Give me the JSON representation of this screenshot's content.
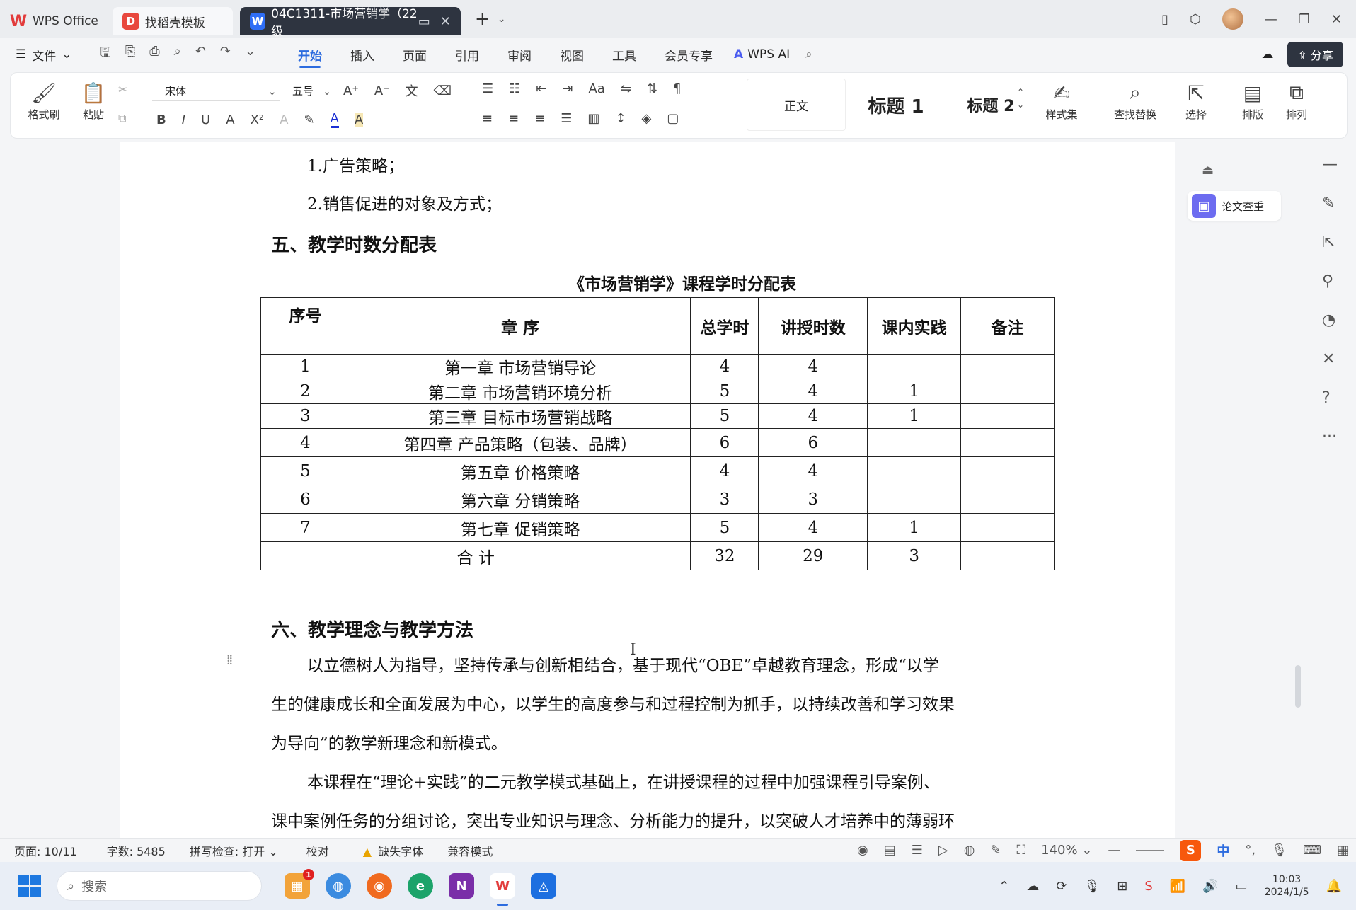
{
  "tabs": {
    "app_name": "WPS Office",
    "template_tab": "找稻壳模板",
    "document_tab": "04C1311-市场营销学（22级"
  },
  "menubar": {
    "file_label": "文件",
    "items": [
      "开始",
      "插入",
      "页面",
      "引用",
      "审阅",
      "视图",
      "工具",
      "会员专享"
    ],
    "active_item": "开始",
    "ai_label": "WPS AI",
    "share_label": "分享"
  },
  "ribbon": {
    "format_painter": "格式刷",
    "paste": "粘贴",
    "font_name": "宋体",
    "font_size": "五号",
    "style_normal": "正文",
    "style_h1": "标题 1",
    "style_h2": "标题 2",
    "style_set": "样式集",
    "find_replace": "查找替换",
    "select": "选择",
    "layout": "排版",
    "arrange": "排列"
  },
  "document": {
    "line1": "1.广告策略；",
    "line2": "2.销售促进的对象及方式；",
    "heading5": "五、教学时数分配表",
    "table_title": "《市场营销学》课程学时分配表",
    "table": {
      "headers": [
        "序号",
        "章 序",
        "总学时",
        "讲授时数",
        "课内实践",
        "备注"
      ],
      "rows": [
        [
          "1",
          "第一章  市场营销导论",
          "4",
          "4",
          "",
          ""
        ],
        [
          "2",
          "第二章  市场营销环境分析",
          "5",
          "4",
          "1",
          ""
        ],
        [
          "3",
          "第三章  目标市场营销战略",
          "5",
          "4",
          "1",
          ""
        ],
        [
          "4",
          "第四章  产品策略（包装、品牌）",
          "6",
          "6",
          "",
          ""
        ],
        [
          "5",
          "第五章  价格策略",
          "4",
          "4",
          "",
          ""
        ],
        [
          "6",
          "第六章  分销策略",
          "3",
          "3",
          "",
          ""
        ],
        [
          "7",
          "第七章  促销策略",
          "5",
          "4",
          "1",
          ""
        ]
      ],
      "total": [
        "合 计",
        "32",
        "29",
        "3",
        ""
      ]
    },
    "heading6": "六、教学理念与教学方法",
    "para1_l1": "以立德树人为指导，坚持传承与创新相结合，基于现代“OBE”卓越教育理念，形成“以学",
    "para1_l2": "生的健康成长和全面发展为中心，以学生的高度参与和过程控制为抓手，以持续改善和学习效果",
    "para1_l3": "为导向”的教学新理念和新模式。",
    "para2_l1": "本课程在“理论+实践”的二元教学模式基础上，在讲授课程的过程中加强课程引导案例、",
    "para2_l2": "课中案例任务的分组讨论，突出专业知识与理念、分析能力的提升，以突破人才培养中的薄弱环"
  },
  "side_panel": {
    "paper_check": "论文查重"
  },
  "statusbar": {
    "page": "页面: 10/11",
    "word_count": "字数: 5485",
    "spell_check": "拼写检查: 打开",
    "proofread": "校对",
    "missing_font": "缺失字体",
    "compat_mode": "兼容模式",
    "zoom": "140%",
    "ime_lang": "中"
  },
  "taskbar": {
    "search_placeholder": "搜索",
    "time": "10:03",
    "date": "2024/1/5",
    "notification_count": "1"
  }
}
